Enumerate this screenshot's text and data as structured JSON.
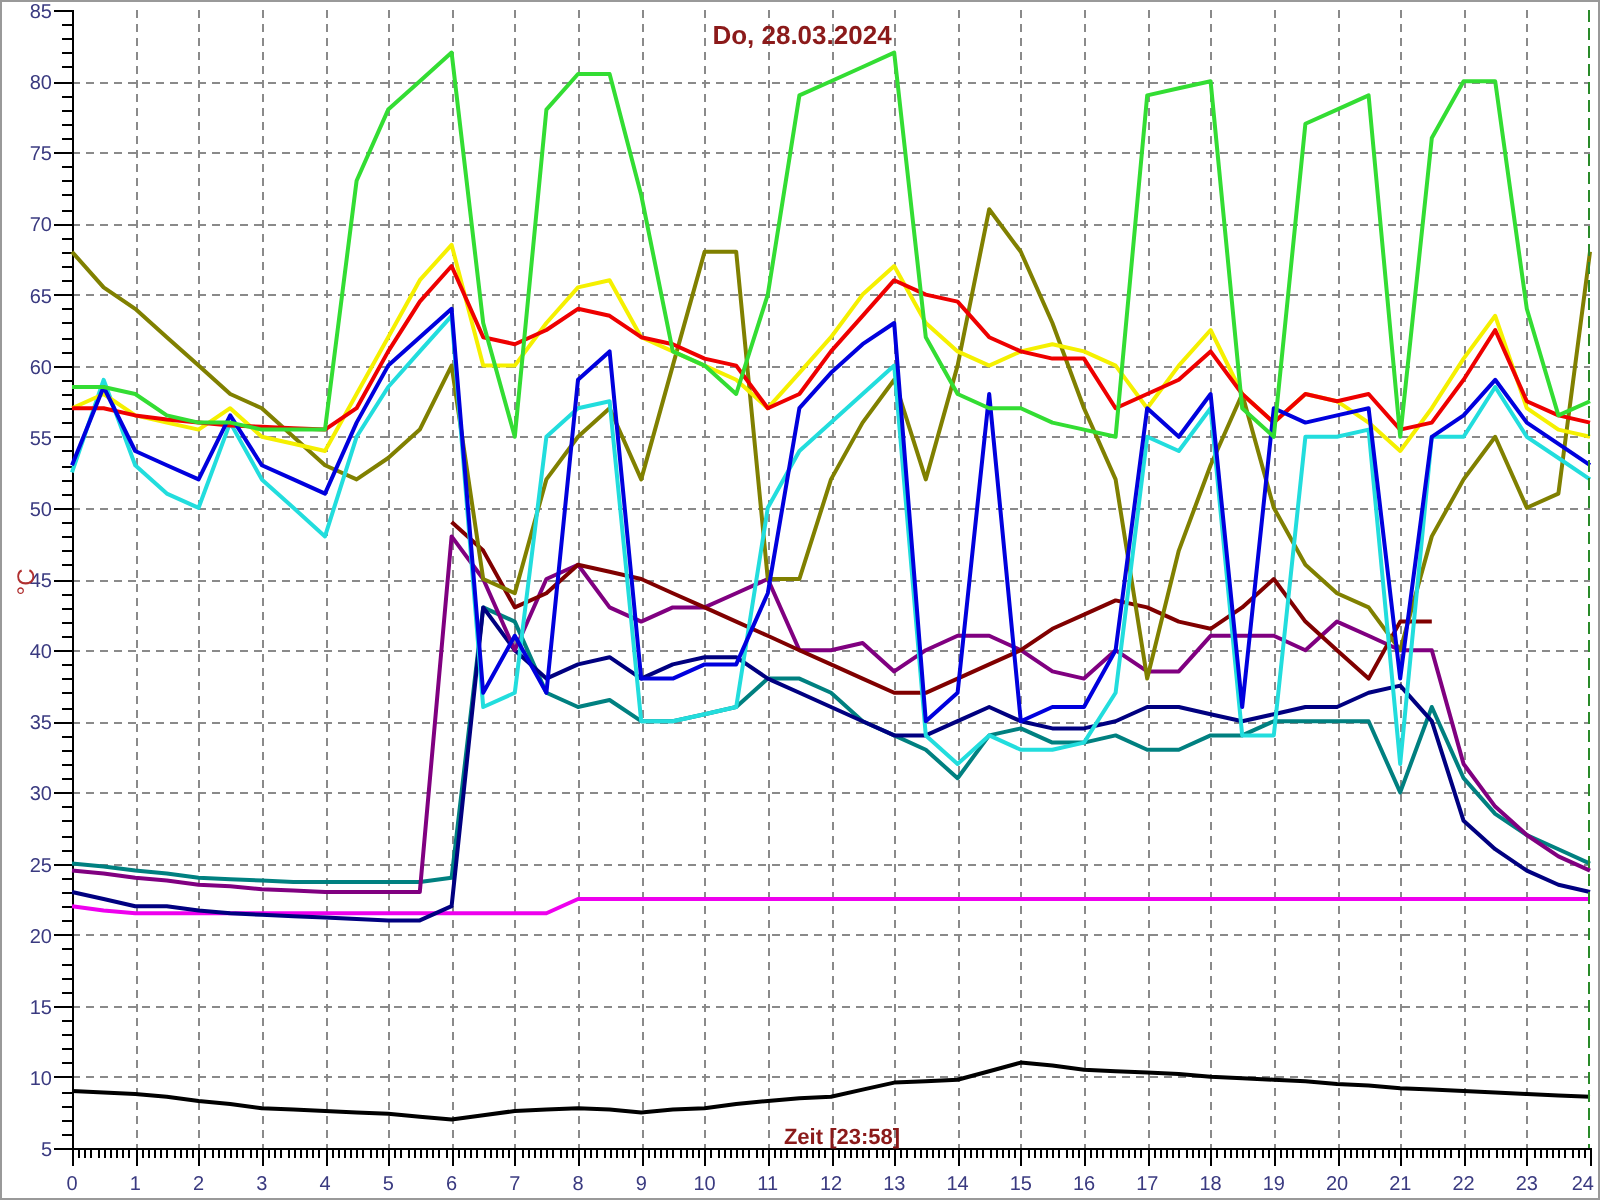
{
  "chart_data": {
    "type": "line",
    "title": "Do, 28.03.2024",
    "xlabel": "Zeit [23:58]",
    "ylabel": "°C",
    "x": [
      0,
      0.5,
      1,
      1.5,
      2,
      2.5,
      3,
      3.5,
      4,
      4.5,
      5,
      5.5,
      6,
      6.5,
      7,
      7.5,
      8,
      8.5,
      9,
      9.5,
      10,
      10.5,
      11,
      11.5,
      12,
      12.5,
      13,
      13.5,
      14,
      14.5,
      15,
      15.5,
      16,
      16.5,
      17,
      17.5,
      18,
      18.5,
      19,
      19.5,
      20,
      20.5,
      21,
      21.5,
      22,
      22.5,
      23,
      23.5,
      24
    ],
    "grid": true,
    "xlim": [
      0,
      24
    ],
    "ylim": [
      5,
      85
    ],
    "xticks": [
      0,
      1,
      2,
      3,
      4,
      5,
      6,
      7,
      8,
      9,
      10,
      11,
      12,
      13,
      14,
      15,
      16,
      17,
      18,
      19,
      20,
      21,
      22,
      23,
      24
    ],
    "yticks": [
      5,
      10,
      15,
      20,
      25,
      30,
      35,
      40,
      45,
      50,
      55,
      60,
      65,
      70,
      75,
      80,
      85
    ],
    "series": [
      {
        "color": "#000000",
        "values": [
          9,
          8.9,
          8.8,
          8.6,
          8.3,
          8.1,
          7.8,
          7.7,
          7.6,
          7.5,
          7.4,
          7.2,
          7,
          7.3,
          7.6,
          7.7,
          7.8,
          7.7,
          7.5,
          7.7,
          7.8,
          8.1,
          8.3,
          8.5,
          8.6,
          9.1,
          9.6,
          9.7,
          9.8,
          10.4,
          11,
          10.8,
          10.5,
          10.4,
          10.3,
          10.2,
          10,
          9.9,
          9.8,
          9.7,
          9.5,
          9.4,
          9.2,
          9.1,
          9,
          8.9,
          8.8,
          8.7,
          8.6
        ]
      },
      {
        "color": "#ee00ee",
        "values": [
          22,
          21.7,
          21.5,
          21.5,
          21.5,
          21.5,
          21.5,
          21.5,
          21.5,
          21.5,
          21.5,
          21.5,
          21.5,
          21.5,
          21.5,
          21.5,
          22.5,
          22.5,
          22.5,
          22.5,
          22.5,
          22.5,
          22.5,
          22.5,
          22.5,
          22.5,
          22.5,
          22.5,
          22.5,
          22.5,
          22.5,
          22.5,
          22.5,
          22.5,
          22.5,
          22.5,
          22.5,
          22.5,
          22.5,
          22.5,
          22.5,
          22.5,
          22.5,
          22.5,
          22.5,
          22.5,
          22.5,
          22.5,
          22.5
        ]
      },
      {
        "color": "#008080",
        "values": [
          25,
          24.8,
          24.5,
          24.3,
          24,
          23.9,
          23.8,
          23.7,
          23.7,
          23.7,
          23.7,
          23.7,
          24,
          43,
          42,
          37,
          36,
          36.5,
          35,
          35,
          35.5,
          36,
          38,
          38,
          37,
          35,
          34,
          33,
          31,
          34,
          34.5,
          33.5,
          33.5,
          34,
          33,
          33,
          34,
          34,
          35,
          35,
          35,
          35,
          30,
          36,
          31,
          28.5,
          27,
          26,
          25
        ]
      },
      {
        "color": "#000080",
        "values": [
          23,
          22.5,
          22,
          22,
          21.7,
          21.5,
          21.4,
          21.3,
          21.2,
          21.1,
          21,
          21,
          22,
          43,
          40,
          38,
          39,
          39.5,
          38,
          39,
          39.5,
          39.5,
          38,
          37,
          36,
          35,
          34,
          34,
          35,
          36,
          35,
          34.5,
          34.5,
          35,
          36,
          36,
          35.5,
          35,
          35.5,
          36,
          36,
          37,
          37.5,
          35,
          28,
          26,
          24.5,
          23.5,
          23
        ]
      },
      {
        "color": "#800080",
        "values": [
          24.5,
          24.3,
          24,
          23.8,
          23.5,
          23.4,
          23.2,
          23.1,
          23,
          23,
          23,
          23,
          48,
          45,
          40,
          45,
          46,
          43,
          42,
          43,
          43,
          44,
          45,
          40,
          40,
          40.5,
          38.5,
          40,
          41,
          41,
          40,
          38.5,
          38,
          40,
          38.5,
          38.5,
          41,
          41,
          41,
          40,
          42,
          41,
          40,
          40,
          32,
          29,
          27,
          25.5,
          24.5
        ]
      },
      {
        "color": "#800000",
        "values": [
          null,
          null,
          null,
          null,
          null,
          null,
          null,
          null,
          null,
          null,
          null,
          null,
          49,
          47,
          43,
          44,
          46,
          45.5,
          45,
          44,
          43,
          42,
          41,
          40,
          39,
          38,
          37,
          37,
          38,
          39,
          40,
          41.5,
          42.5,
          43.5,
          43,
          42,
          41.5,
          43,
          45,
          42,
          40,
          38,
          42,
          42,
          null,
          null,
          null,
          null,
          null
        ]
      },
      {
        "color": "#808000",
        "values": [
          68,
          65.5,
          64,
          62,
          60,
          58,
          57,
          55,
          53,
          52,
          53.5,
          55.5,
          60,
          45,
          44,
          52,
          55,
          57,
          52,
          60,
          68,
          68,
          45,
          45,
          52,
          56,
          59,
          52,
          60,
          71,
          68,
          63,
          57,
          52,
          38,
          47,
          53,
          58,
          50,
          46,
          44,
          43,
          40,
          48,
          52,
          55,
          50,
          51,
          68
        ]
      },
      {
        "color": "#22dddd",
        "values": [
          52.5,
          59,
          53,
          51,
          50,
          56,
          52,
          50,
          48,
          55,
          58.5,
          61,
          63.5,
          36,
          37,
          55,
          57,
          57.5,
          35,
          35,
          35.5,
          36,
          50,
          54,
          56,
          58,
          60,
          34,
          32,
          34,
          33,
          33,
          33.5,
          37,
          55,
          54,
          57,
          34,
          34,
          55,
          55,
          55.5,
          32,
          55,
          55,
          58.5,
          55,
          53.5,
          52
        ]
      },
      {
        "color": "#f5f000",
        "values": [
          57,
          58,
          56.5,
          56,
          55.5,
          57,
          55,
          54.5,
          54,
          58,
          62,
          66,
          68.5,
          60,
          60,
          63,
          65.5,
          66,
          62,
          61,
          60,
          59,
          57,
          59.5,
          62,
          65,
          67,
          63,
          61,
          60,
          61,
          61.5,
          61,
          60,
          57,
          60,
          62.5,
          58,
          56,
          58,
          57.5,
          56,
          54,
          57,
          60.5,
          63.5,
          57,
          55.5,
          55
        ]
      },
      {
        "color": "#ee0000",
        "values": [
          57,
          57,
          56.5,
          56.2,
          56,
          55.8,
          55.7,
          55.6,
          55.5,
          57,
          61,
          64.5,
          67,
          62,
          61.5,
          62.5,
          64,
          63.5,
          62,
          61.5,
          60.5,
          60,
          57,
          58,
          61,
          63.5,
          66,
          65,
          64.5,
          62,
          61,
          60.5,
          60.5,
          57,
          58,
          59,
          61,
          58,
          56,
          58,
          57.5,
          58,
          55.5,
          56,
          59,
          62.5,
          57.5,
          56.5,
          56
        ]
      },
      {
        "color": "#0000dd",
        "values": [
          53,
          58.5,
          54,
          53,
          52,
          56.5,
          53,
          52,
          51,
          56,
          60,
          62,
          64,
          37,
          41,
          37,
          59,
          61,
          38,
          38,
          39,
          39,
          44,
          57,
          59.5,
          61.5,
          63,
          35,
          37,
          58,
          35,
          36,
          36,
          40,
          57,
          55,
          58,
          36,
          57,
          56,
          56.5,
          57,
          38,
          55,
          56.5,
          59,
          56,
          54.5,
          53
        ]
      },
      {
        "color": "#33dd33",
        "values": [
          58.5,
          58.5,
          58,
          56.5,
          56,
          56,
          55.5,
          55.5,
          55.5,
          73,
          78,
          80,
          82,
          63,
          55,
          78,
          80.5,
          80.5,
          72,
          61,
          60,
          58,
          65,
          79,
          80,
          81,
          82,
          62,
          58,
          57,
          57,
          56,
          55.5,
          55,
          79,
          79.5,
          80,
          57,
          55,
          77,
          78,
          79,
          55,
          76,
          80,
          80,
          64,
          56.5,
          57.5
        ]
      }
    ]
  }
}
